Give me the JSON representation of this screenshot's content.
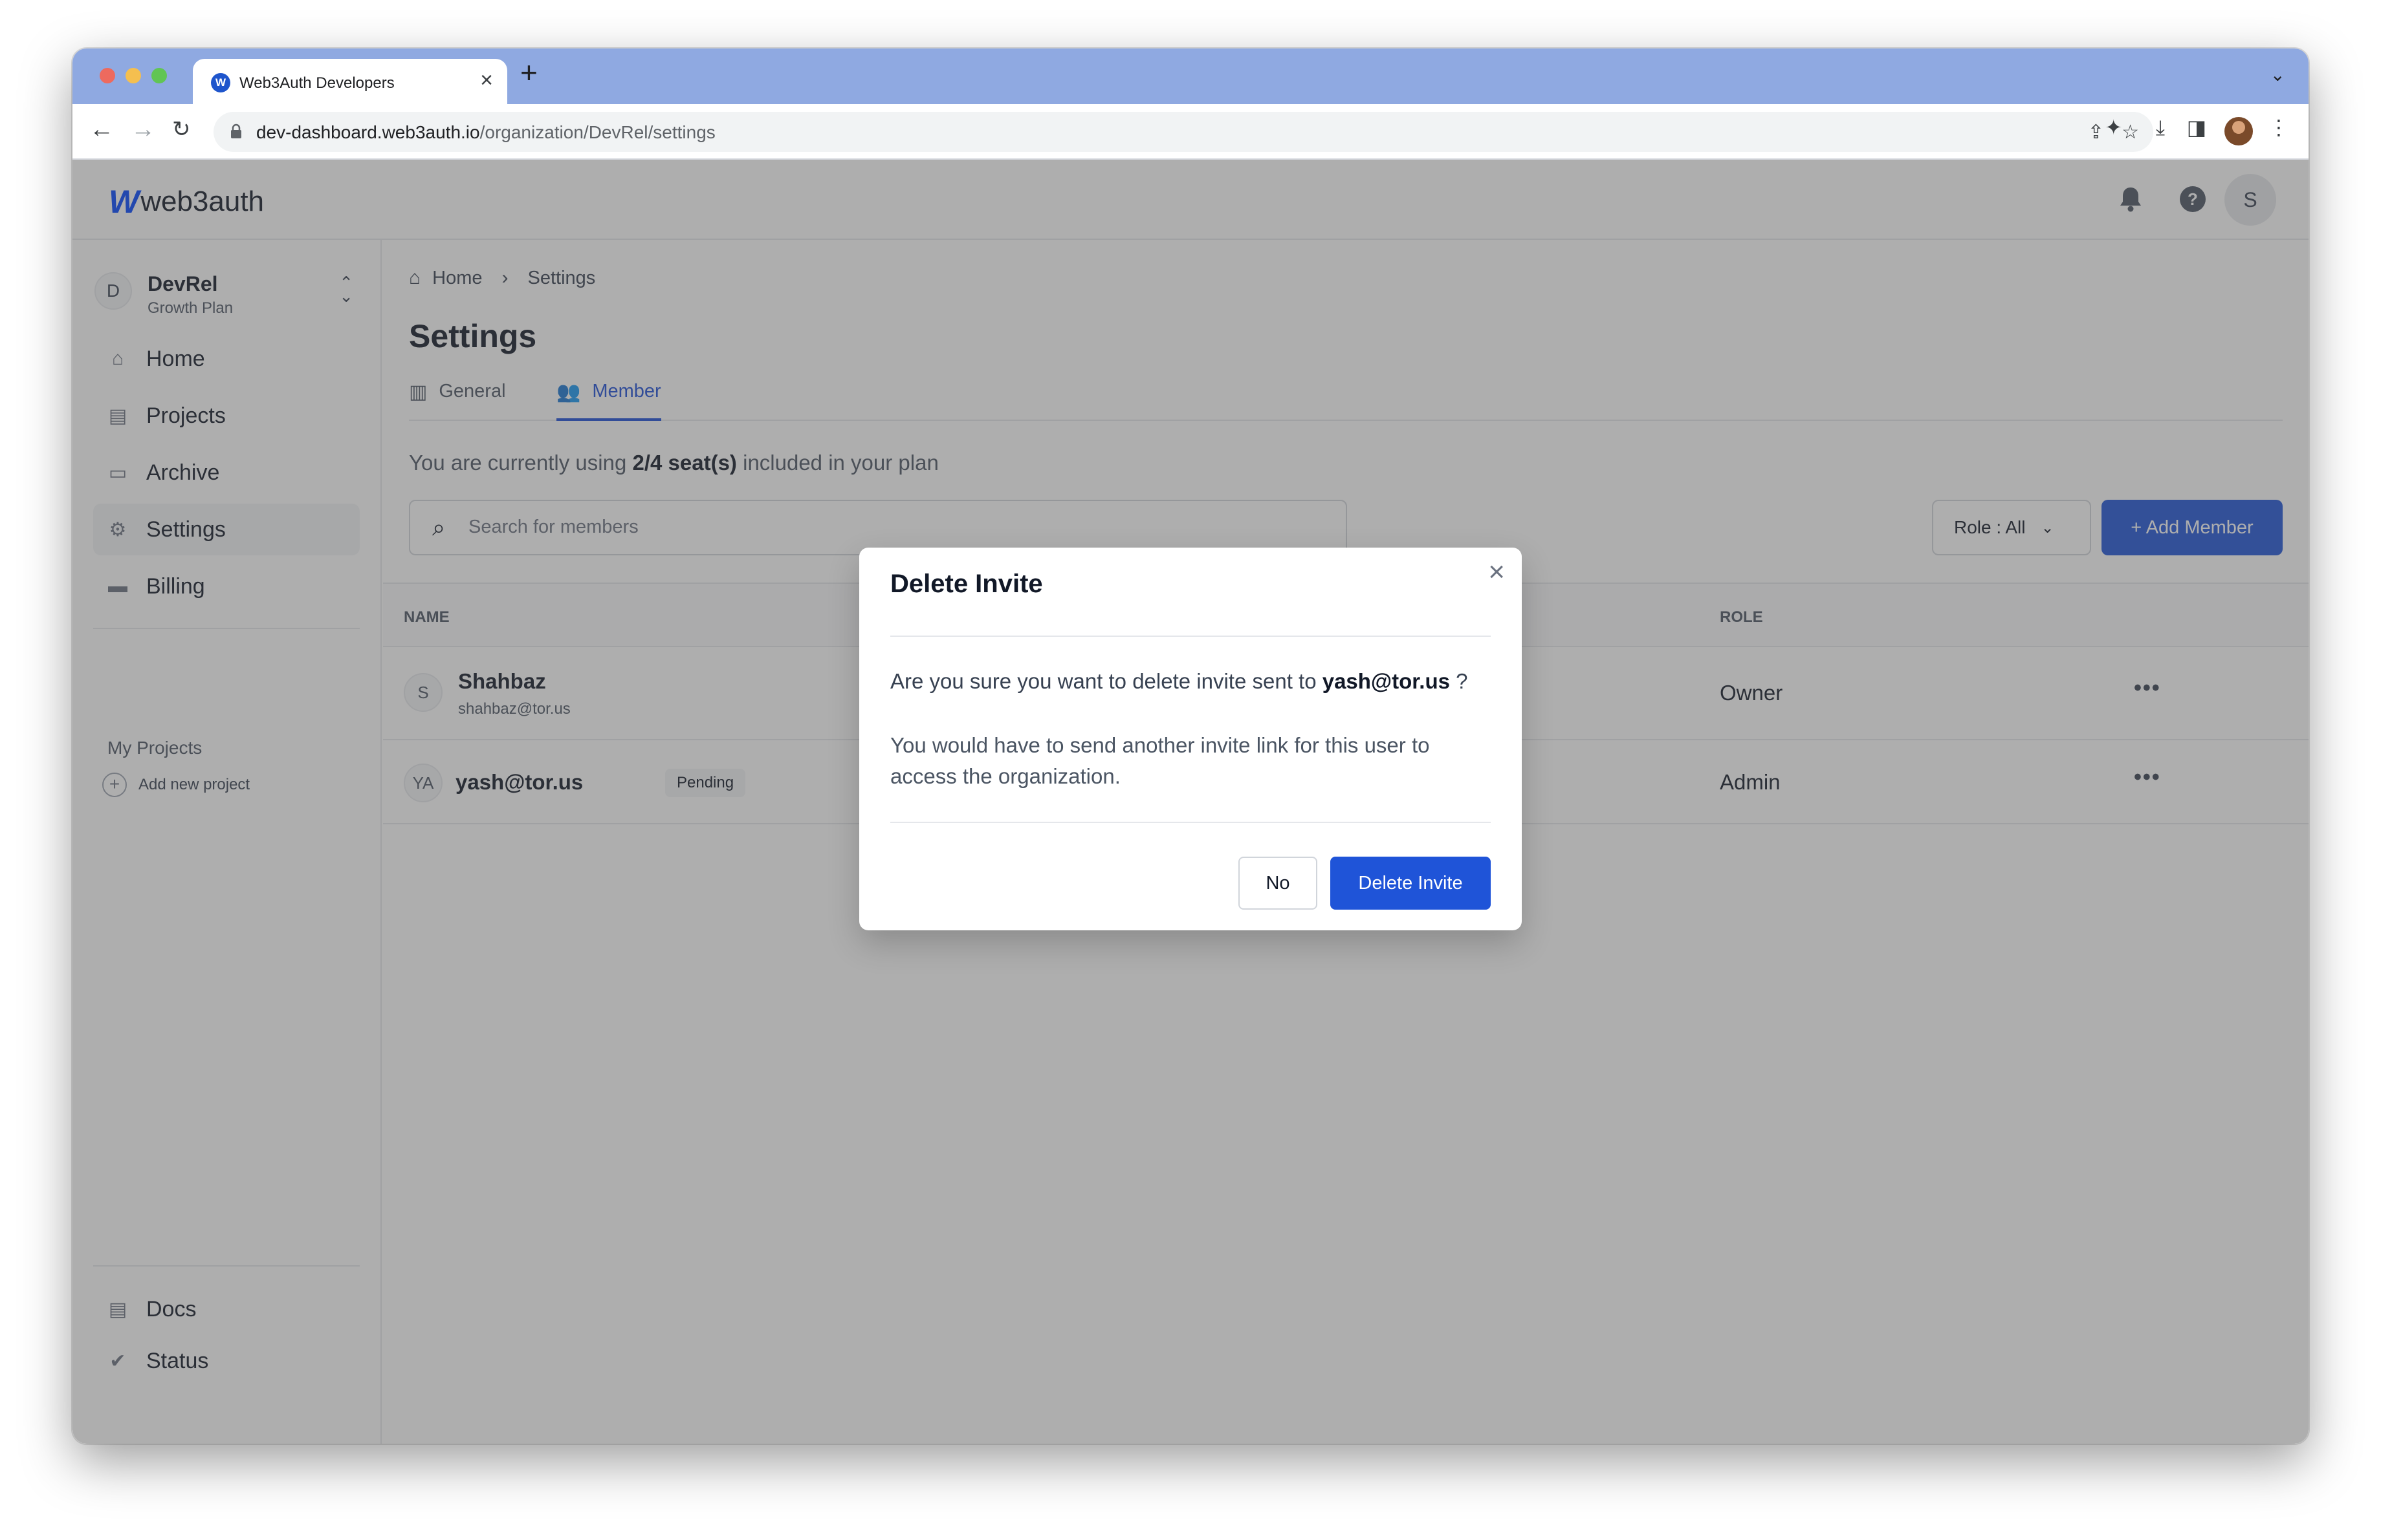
{
  "browser": {
    "tab_title": "Web3Auth Developers",
    "favicon_letter": "W",
    "new_tab": "+",
    "url_domain": "dev-dashboard.web3auth.io",
    "url_path": "/organization/DevRel/settings"
  },
  "header": {
    "logo_mark": "W",
    "logo_text": "web3auth",
    "avatar_letter": "S"
  },
  "sidebar": {
    "org": {
      "avatar_letter": "D",
      "name": "DevRel",
      "plan": "Growth Plan"
    },
    "items": [
      {
        "label": "Home",
        "icon": "home-icon"
      },
      {
        "label": "Projects",
        "icon": "document-icon"
      },
      {
        "label": "Archive",
        "icon": "archive-icon"
      },
      {
        "label": "Settings",
        "icon": "gear-icon",
        "active": true
      },
      {
        "label": "Billing",
        "icon": "credit-card-icon"
      }
    ],
    "my_projects_label": "My Projects",
    "add_project_label": "Add new project",
    "footer_items": [
      {
        "label": "Docs",
        "icon": "document-icon"
      },
      {
        "label": "Status",
        "icon": "check-circle-icon"
      }
    ]
  },
  "main": {
    "breadcrumb": [
      "Home",
      "Settings"
    ],
    "title": "Settings",
    "tabs": [
      {
        "label": "General",
        "icon": "building-icon"
      },
      {
        "label": "Member",
        "icon": "users-icon",
        "active": true
      }
    ],
    "seats_prefix": "You are currently using ",
    "seats_value": "2/4 seat(s)",
    "seats_suffix": " included in your plan",
    "search_placeholder": "Search for members",
    "role_filter": "Role : All",
    "add_member": "+ Add Member",
    "table": {
      "columns": [
        "NAME",
        "ROLE"
      ],
      "rows": [
        {
          "avatar": "S",
          "name": "Shahbaz",
          "email": "shahbaz@tor.us",
          "role": "Owner"
        },
        {
          "avatar": "YA",
          "name": "yash@tor.us",
          "badge": "Pending",
          "role": "Admin"
        }
      ]
    }
  },
  "modal": {
    "title": "Delete Invite",
    "question_prefix": "Are you sure you want to delete invite sent to ",
    "question_email": "yash@tor.us",
    "question_suffix": " ?",
    "info": "You would have to send another invite link for this user to access the organization.",
    "cancel_label": "No",
    "confirm_label": "Delete Invite"
  },
  "colors": {
    "primary": "#1f54d8",
    "overlay": "rgba(75,75,75,0.45)"
  }
}
